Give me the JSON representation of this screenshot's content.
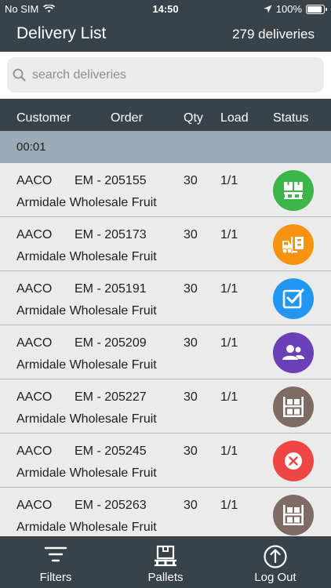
{
  "status_bar": {
    "carrier": "No SIM",
    "time": "14:50",
    "battery": "100%"
  },
  "header": {
    "title": "Delivery List",
    "count": "279 deliveries"
  },
  "search": {
    "placeholder": "search deliveries"
  },
  "columns": {
    "customer": "Customer",
    "order": "Order",
    "qty": "Qty",
    "load": "Load",
    "status": "Status"
  },
  "group": {
    "label": "00:01"
  },
  "colors": {
    "bar": "#394149",
    "group": "#9aabb7",
    "green": "#3cb54a",
    "orange": "#f7930f",
    "blue": "#2196f3",
    "purple": "#6a3fb8",
    "brown": "#7e6b63",
    "red": "#f04545"
  },
  "rows": [
    {
      "customer": "AACO",
      "order": "EM - 205155",
      "qty": "30",
      "load": "1/1",
      "name": "Armidale Wholesale Fruit",
      "status_icon": "pallet-boxes-icon",
      "status_color": "green"
    },
    {
      "customer": "AACO",
      "order": "EM - 205173",
      "qty": "30",
      "load": "1/1",
      "name": "Armidale Wholesale Fruit",
      "status_icon": "forklift-icon",
      "status_color": "orange"
    },
    {
      "customer": "AACO",
      "order": "EM - 205191",
      "qty": "30",
      "load": "1/1",
      "name": "Armidale Wholesale Fruit",
      "status_icon": "checkbox-icon",
      "status_color": "blue"
    },
    {
      "customer": "AACO",
      "order": "EM - 205209",
      "qty": "30",
      "load": "1/1",
      "name": "Armidale Wholesale Fruit",
      "status_icon": "users-icon",
      "status_color": "purple"
    },
    {
      "customer": "AACO",
      "order": "EM - 205227",
      "qty": "30",
      "load": "1/1",
      "name": "Armidale Wholesale Fruit",
      "status_icon": "warehouse-shelf-icon",
      "status_color": "brown"
    },
    {
      "customer": "AACO",
      "order": "EM - 205245",
      "qty": "30",
      "load": "1/1",
      "name": "Armidale Wholesale Fruit",
      "status_icon": "cancel-icon",
      "status_color": "red"
    },
    {
      "customer": "AACO",
      "order": "EM - 205263",
      "qty": "30",
      "load": "1/1",
      "name": "Armidale Wholesale Fruit",
      "status_icon": "warehouse-shelf-icon",
      "status_color": "brown"
    }
  ],
  "tabs": [
    {
      "label": "Filters",
      "icon": "filter-icon"
    },
    {
      "label": "Pallets",
      "icon": "pallet-icon"
    },
    {
      "label": "Log Out",
      "icon": "logout-icon"
    }
  ]
}
